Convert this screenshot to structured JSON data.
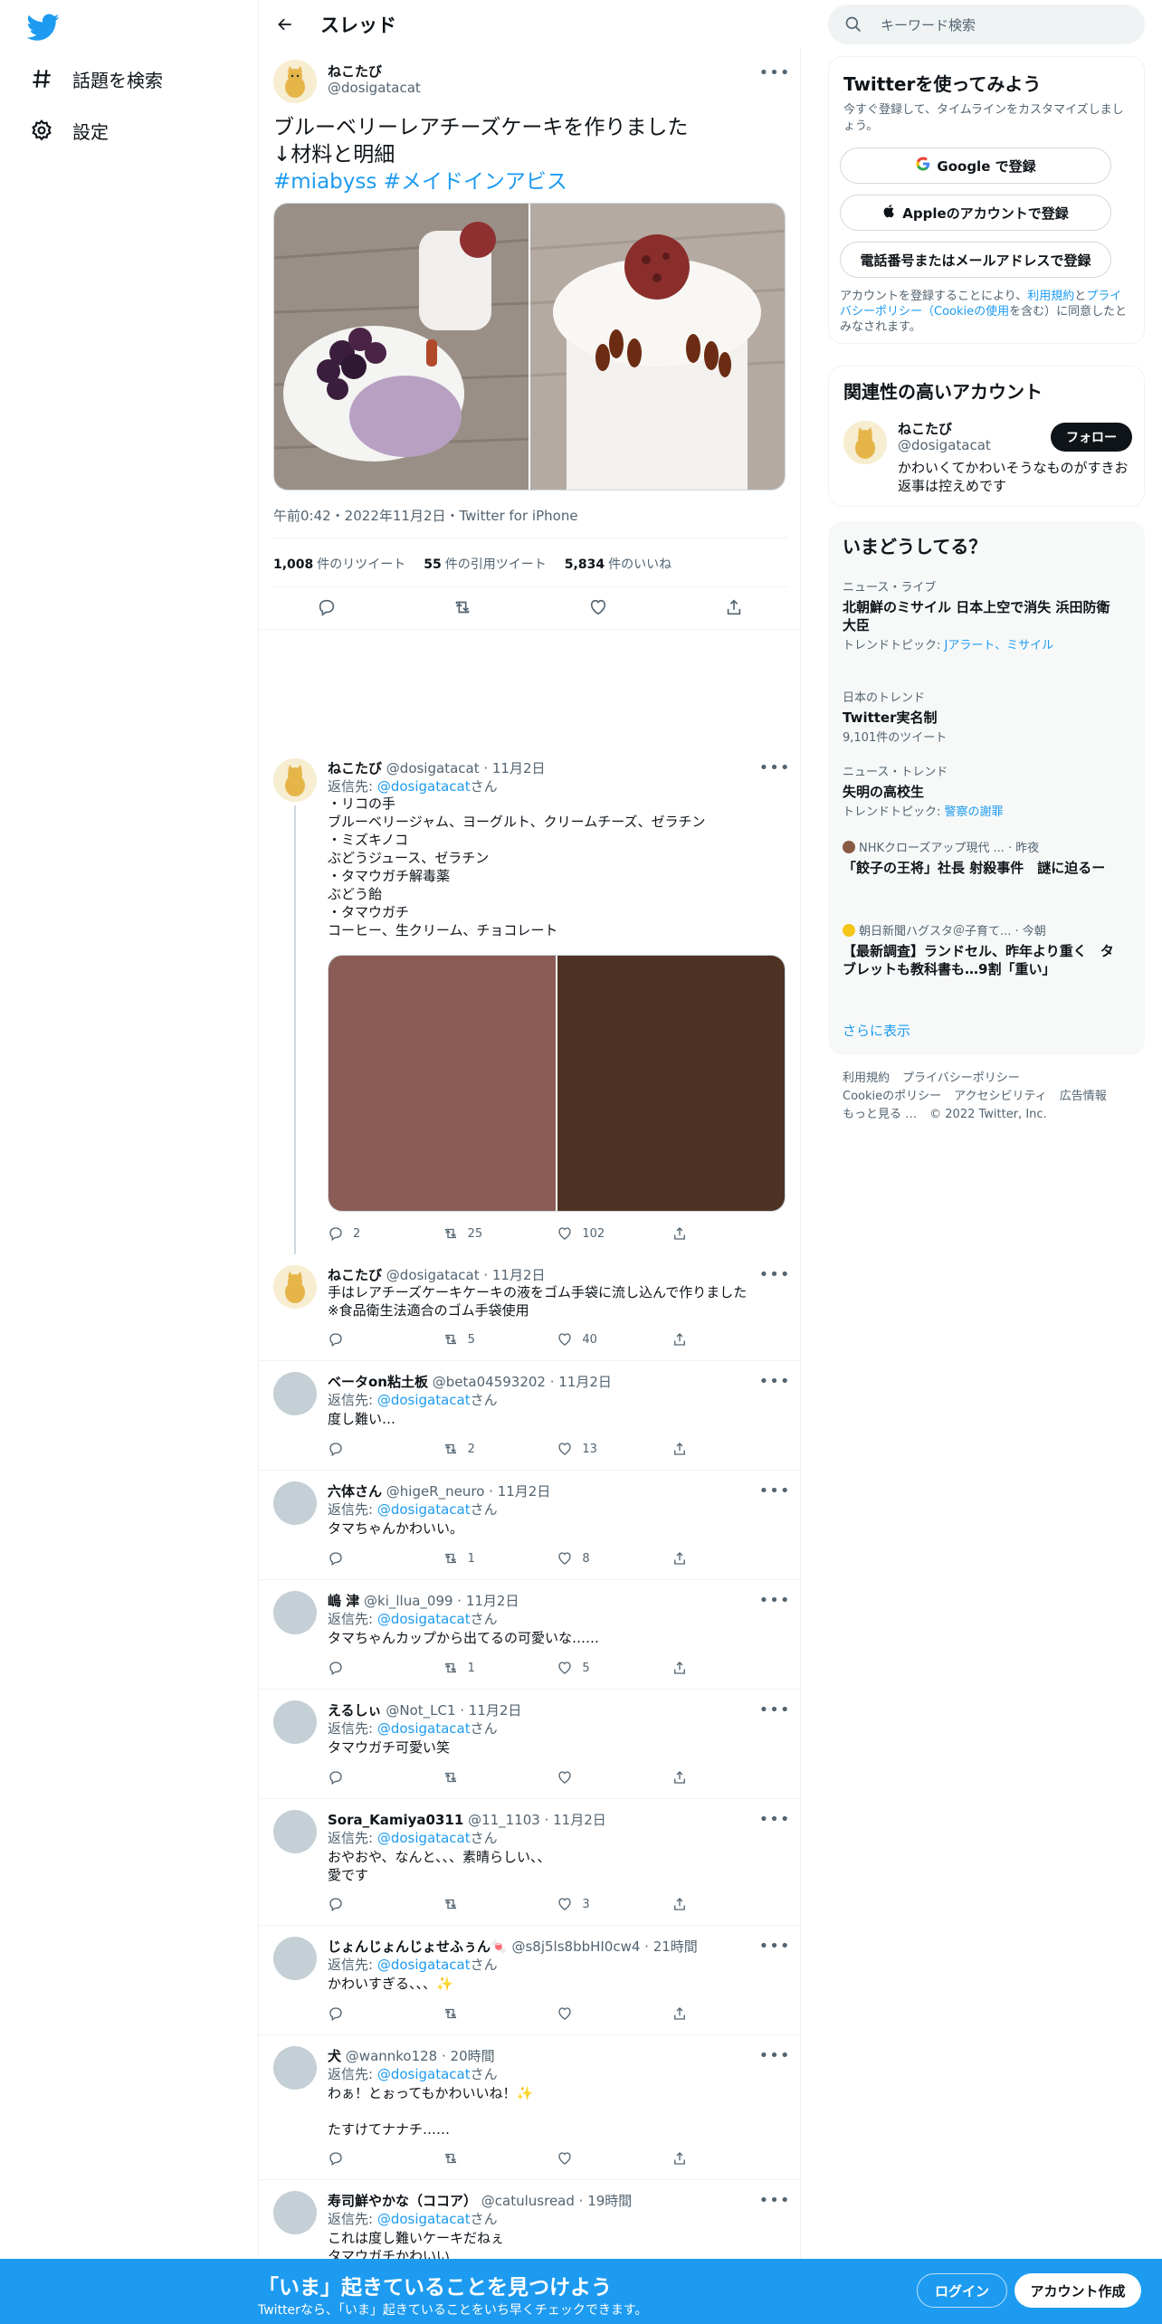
{
  "nav": {
    "explore_label": "話題を検索",
    "settings_label": "設定"
  },
  "header": {
    "title": "スレッド"
  },
  "main_tweet": {
    "name": "ねこたび",
    "handle": "@dosigatacat",
    "text_line1": "ブルーベリーレアチーズケーキを作りました",
    "text_line2": "↓材料と明細",
    "hashtag1": "#miabyss",
    "hashtag2": "#メイドインアビス",
    "timestamp": "午前0:42・2022年11月2日・Twitter for iPhone",
    "retweets_count": "1,008",
    "retweets_label": "件のリツイート",
    "quotes_count": "55",
    "quotes_label": "件の引用ツイート",
    "likes_count": "5,834",
    "likes_label": "件のいいね"
  },
  "replies": [
    {
      "name": "ねこたび",
      "handle": "@dosigatacat · 11月2日",
      "reply_prefix": "返信先: ",
      "reply_to": "@dosigatacat",
      "reply_suffix": "さん",
      "body": "・リコの手\nブルーベリージャム、ヨーグルト、クリームチーズ、ゼラチン\n・ミズキノコ\nぶどうジュース、ゼラチン\n・タマウガチ解毒薬\nぶどう飴\n・タマウガチ\nコーヒー、生クリーム、チョコレート",
      "replies": "2",
      "retweets": "25",
      "likes": "102"
    },
    {
      "name": "ねこたび",
      "handle": "@dosigatacat · 11月2日",
      "body": "手はレアチーズケーキケーキの液をゴム手袋に流し込んで作りました\n※食品衛生法適合のゴム手袋使用",
      "replies": "",
      "retweets": "5",
      "likes": "40"
    },
    {
      "name": "ベータon粘土板",
      "handle": "@beta04593202 · 11月2日",
      "reply_prefix": "返信先: ",
      "reply_to": "@dosigatacat",
      "reply_suffix": "さん",
      "body": "度し難い…",
      "replies": "",
      "retweets": "2",
      "likes": "13"
    },
    {
      "name": "六体さん",
      "handle": "@higeR_neuro · 11月2日",
      "reply_prefix": "返信先: ",
      "reply_to": "@dosigatacat",
      "reply_suffix": "さん",
      "body": "タマちゃんかわいい。",
      "replies": "",
      "retweets": "1",
      "likes": "8"
    },
    {
      "name": "嶋 津",
      "handle": "@ki_llua_099 · 11月2日",
      "reply_prefix": "返信先: ",
      "reply_to": "@dosigatacat",
      "reply_suffix": "さん",
      "body": "タマちゃんカップから出てるの可愛いな……",
      "replies": "",
      "retweets": "1",
      "likes": "5"
    },
    {
      "name": "えるしぃ",
      "handle": "@Not_LC1 · 11月2日",
      "reply_prefix": "返信先: ",
      "reply_to": "@dosigatacat",
      "reply_suffix": "さん",
      "body": "タマウガチ可愛い笑",
      "replies": "",
      "retweets": "",
      "likes": ""
    },
    {
      "name": "Sora_Kamiya0311",
      "handle": "@11_1103 · 11月2日",
      "reply_prefix": "返信先: ",
      "reply_to": "@dosigatacat",
      "reply_suffix": "さん",
      "body": "おやおや、なんと、、、素晴らしい、、\n愛です",
      "replies": "",
      "retweets": "",
      "likes": "3"
    },
    {
      "name": "じょんじょんじょせふぅん🍬",
      "handle": "@s8j5ls8bbHI0cw4 · 21時間",
      "reply_prefix": "返信先: ",
      "reply_to": "@dosigatacat",
      "reply_suffix": "さん",
      "body": "かわいすぎる、、、✨",
      "replies": "",
      "retweets": "",
      "likes": ""
    },
    {
      "name": "犬",
      "handle": "@wannko128 · 20時間",
      "reply_prefix": "返信先: ",
      "reply_to": "@dosigatacat",
      "reply_suffix": "さん",
      "body": "わぁ！とぉってもかわいいね！✨\n\nたすけてナナチ……",
      "replies": "",
      "retweets": "",
      "likes": ""
    },
    {
      "name": "寿司鮮やかな（ココア）",
      "handle": "@catulusread · 19時間",
      "reply_prefix": "返信先: ",
      "reply_to": "@dosigatacat",
      "reply_suffix": "さん",
      "body": "これは度し難いケーキだねぇ\nタマウガチかわいい",
      "replies": "",
      "retweets": "",
      "likes": ""
    }
  ],
  "right": {
    "search_placeholder": "キーワード検索",
    "signup_title": "Twitterを使ってみよう",
    "signup_desc": "今すぐ登録して、タイムラインをカスタマイズしましょう。",
    "google_btn": "Google で登録",
    "apple_btn": "Appleのアカウントで登録",
    "phone_btn": "電話番号またはメールアドレスで登録",
    "legal_prefix": "アカウントを登録することにより、",
    "legal_terms": "利用規約",
    "legal_and": "と",
    "legal_privacy": "プライバシーポリシー",
    "legal_cookie": "（Cookieの使用",
    "legal_suffix": "を含む）に同意したとみなされます。",
    "related_title": "関連性の高いアカウント",
    "related_name": "ねこたび",
    "related_handle": "@dosigatacat",
    "related_bio": "かわいくてかわいそうなものがすきお返事は控えめです",
    "follow_btn": "フォロー",
    "trends_title": "いまどうしてる？",
    "trends": [
      {
        "category": "ニュース・ライブ",
        "title": "北朝鮮のミサイル 日本上空で消失 浜田防衛大臣",
        "sub_prefix": "トレンドトピック: ",
        "sub_link": "Jアラート、ミサイル"
      },
      {
        "category": "日本のトレンド",
        "title": "Twitter実名制",
        "sub_prefix": "9,101件のツイート",
        "sub_link": ""
      },
      {
        "category": "ニュース・トレンド",
        "title": "失明の高校生",
        "sub_prefix": "トレンドトピック: ",
        "sub_link": "警察の謝罪"
      },
      {
        "category": "NHKクローズアップ現代 ... · 昨夜",
        "title": "「餃子の王将」社長 射殺事件　謎に迫るー",
        "sub_prefix": "",
        "sub_link": ""
      },
      {
        "category": "朝日新聞ハグスタ＠子育て... · 今朝",
        "title": "【最新調査】ランドセル、昨年より重く　タブレットも教科書も…9割「重い」",
        "sub_prefix": "",
        "sub_link": ""
      }
    ],
    "show_more": "さらに表示",
    "footer": [
      "利用規約",
      "プライバシーポリシー",
      "Cookieのポリシー",
      "アクセシビリティ",
      "広告情報",
      "もっと見る …",
      "© 2022 Twitter, Inc."
    ]
  },
  "bottom_bar": {
    "title": "「いま」起きていることを見つけよう",
    "subtitle": "Twitterなら、「いま」起きていることをいち早くチェックできます。",
    "login": "ログイン",
    "signup": "アカウント作成"
  },
  "colors": {
    "brand": "#1d9bf0",
    "text": "#0f1419",
    "muted": "#536471"
  }
}
